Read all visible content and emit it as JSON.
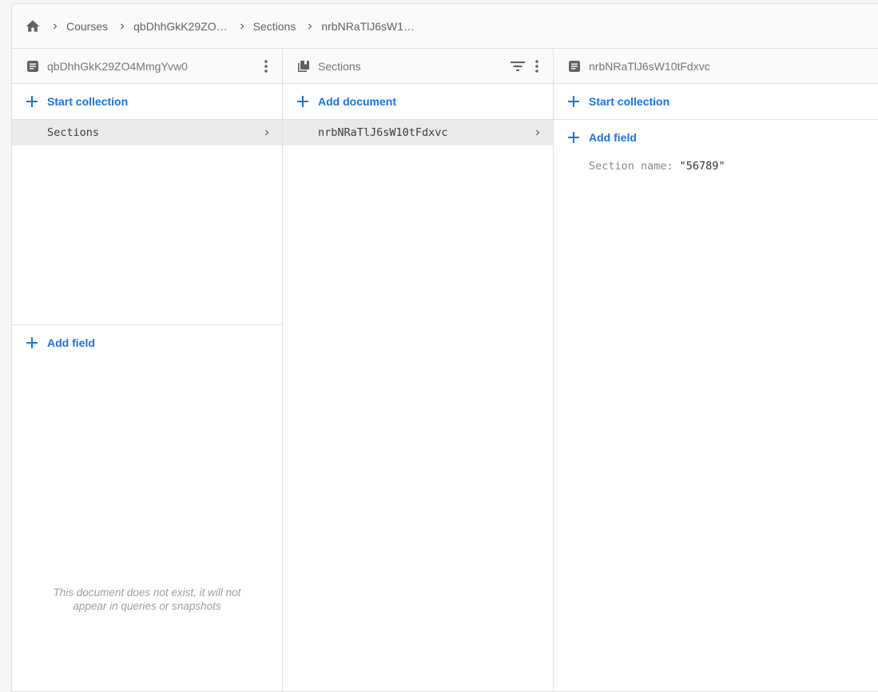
{
  "breadcrumb": {
    "home_icon": "home-icon",
    "separator_icon": "chevron-right-icon",
    "items": [
      "Courses",
      "qbDhhGkK29ZO…",
      "Sections",
      "nrbNRaTlJ6sW1…"
    ]
  },
  "columns": [
    {
      "header": {
        "icon": "document-icon",
        "title": "qbDhhGkK29ZO4MmgYvw0",
        "menu_icon": "more-vert-icon"
      },
      "action": {
        "icon": "plus-icon",
        "label": "Start collection"
      },
      "items": [
        {
          "label": "Sections",
          "icon": "chevron-right-icon"
        }
      ],
      "field_action": {
        "icon": "plus-icon",
        "label": "Add field"
      },
      "notice": "This document does not exist, it will not appear in queries or snapshots"
    },
    {
      "header": {
        "icon": "collection-icon",
        "title": "Sections",
        "filter_icon": "filter-icon",
        "menu_icon": "more-vert-icon"
      },
      "action": {
        "icon": "plus-icon",
        "label": "Add document"
      },
      "items": [
        {
          "label": "nrbNRaTlJ6sW10tFdxvc",
          "icon": "chevron-right-icon"
        }
      ]
    },
    {
      "header": {
        "icon": "document-icon",
        "title": "nrbNRaTlJ6sW10tFdxvc"
      },
      "action": {
        "icon": "plus-icon",
        "label": "Start collection"
      },
      "field_action": {
        "icon": "plus-icon",
        "label": "Add field"
      },
      "fields": [
        {
          "key": "Section name:",
          "value": "\"56789\""
        }
      ]
    }
  ],
  "colors": {
    "accent": "#1a73e8",
    "text_muted": "#757575",
    "row_selected": "#eaeaea"
  }
}
